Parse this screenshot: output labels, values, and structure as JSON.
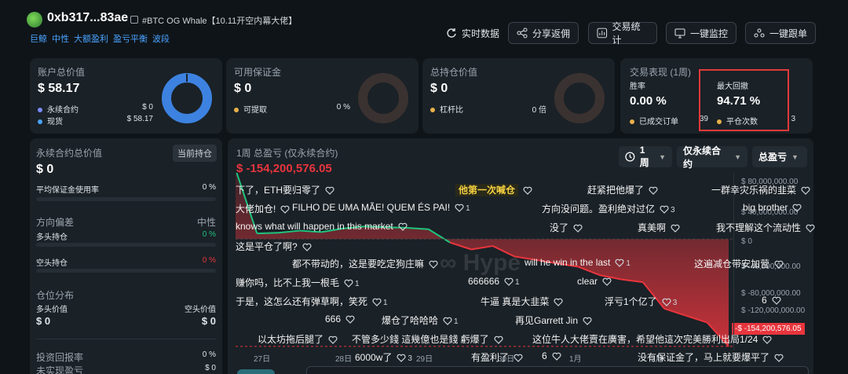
{
  "header": {
    "address": "0xb317...83ae",
    "title_tag": "#BTC OG Whale【10.11开空内幕大佬】",
    "tags": [
      "巨鲸",
      "中性",
      "大额盈利",
      "盈亏平衡",
      "波段"
    ],
    "buttons": [
      "实时数据",
      "分享返佣",
      "交易统计",
      "一键监控",
      "一键跟单"
    ]
  },
  "account": {
    "label": "账户总价值",
    "value": "$ 58.17",
    "rows": [
      {
        "label": "永续合约",
        "value": "$ 0"
      },
      {
        "label": "现货",
        "value": "$ 58.17"
      }
    ]
  },
  "margin": {
    "label": "可用保证金",
    "value": "$ 0",
    "rows": [
      {
        "label": "可提取",
        "value": "0 %"
      }
    ]
  },
  "position": {
    "label": "总持仓价值",
    "value": "$ 0",
    "rows": [
      {
        "label": "杠杆比",
        "value": "0 倍"
      }
    ]
  },
  "performance": {
    "label": "交易表现 (1周)",
    "win_label": "胜率",
    "win": "0.00 %",
    "trades_label": "已成交订单",
    "trades": "39",
    "dd_label": "最大回撤",
    "dd": "94.71 %",
    "count_label": "平仓次数",
    "count": "3"
  },
  "left": {
    "perp_label": "永续合约总价值",
    "current_btn": "当前持仓",
    "perp_value": "$ 0",
    "avg_margin_label": "平均保证金使用率",
    "avg_margin": "0 %",
    "bias_label": "方向偏差",
    "bias_value": "中性",
    "long_label": "多头持仓",
    "long": "0 %",
    "short_label": "空头持仓",
    "short": "0 %",
    "dist_label": "仓位分布",
    "long_val_label": "多头价值",
    "short_val_label": "空头价值",
    "long_val": "$ 0",
    "short_val": "$ 0",
    "roi_label": "投资回报率",
    "roi": "0 %",
    "unreal_label": "未实现盈亏",
    "unreal": "$ 0"
  },
  "chart_panel": {
    "title": "1周 总盈亏 (仅永续合约)",
    "pnl": "$ -154,200,576.05",
    "dd_period": "1周",
    "dd_scope": "仅永续合约",
    "dd_metric": "总盈亏",
    "badge": "-$ -154,200,576.05",
    "danmaku": [
      {
        "t": "下了，ETH要归零了",
        "h": ""
      },
      {
        "t": "他第一次喊仓",
        "h": ""
      },
      {
        "t": "赶紧把他爆了",
        "h": ""
      },
      {
        "t": "一群幸灾乐祸的韭菜",
        "h": ""
      },
      {
        "t": "大佬加仓!",
        "h": ""
      },
      {
        "t": "FILHO DE UMA MÃE! QUEM ÉS PAI!",
        "h": "1"
      },
      {
        "t": "方向没问题。盈利绝对过亿",
        "h": "3"
      },
      {
        "t": "big brother",
        "h": ""
      },
      {
        "t": "knows what will happen in this market",
        "h": ""
      },
      {
        "t": "没了",
        "h": ""
      },
      {
        "t": "真美啊",
        "h": ""
      },
      {
        "t": "我不理解这个流动性",
        "h": ""
      },
      {
        "t": "这是平仓了啊?",
        "h": ""
      },
      {
        "t": "都不带动的，这是要吃定狗庄嘛",
        "h": ""
      },
      {
        "t": "will he win in the last",
        "h": "1"
      },
      {
        "t": "这遍减仓带安加营",
        "h": ""
      },
      {
        "t": "赚你吗，比不上我一根毛",
        "h": "1"
      },
      {
        "t": "666666",
        "h": "1"
      },
      {
        "t": "clear",
        "h": ""
      },
      {
        "t": "于是，这怎么还有弹草啊，笑死",
        "h": "1"
      },
      {
        "t": "牛逼 真是大韭菜",
        "h": ""
      },
      {
        "t": "浮亏1个亿了",
        "h": "3"
      },
      {
        "t": "6",
        "h": ""
      },
      {
        "t": "666",
        "h": ""
      },
      {
        "t": "爆仓了哈哈哈",
        "h": "1"
      },
      {
        "t": "再见Garrett Jin",
        "h": ""
      },
      {
        "t": "以太坊拖后腿了",
        "h": ""
      },
      {
        "t": "不管多少錢 這幾億也是錢 虧爆了",
        "h": ""
      },
      {
        "t": "这位牛人大佬賣在廣害，希望他這次完美勝利出局1/24",
        "h": ""
      },
      {
        "t": "6000w了",
        "h": "3"
      },
      {
        "t": "有盈利了",
        "h": ""
      },
      {
        "t": "6",
        "h": ""
      },
      {
        "t": "没有保证金了，马上就要爆平了",
        "h": ""
      }
    ]
  },
  "chart_data": {
    "type": "area",
    "x": [
      "27日",
      "28日",
      "29日",
      "30日",
      "1月",
      "2月"
    ],
    "y_ticks": [
      "$ 80,000,000.00",
      "$ 40,000,000.00",
      "$ 0",
      "$ -40,000,000.00",
      "$ -80,000,000.00",
      "$ -120,000,000.00"
    ],
    "ylim": [
      -160000000,
      95000000
    ],
    "values": [
      100000000,
      8000000,
      9000000,
      12000000,
      10000000,
      15000000,
      18000000,
      17000000,
      16000000,
      14000000,
      -5000000,
      -15000000,
      -10000000,
      -25000000,
      -30000000,
      -35000000,
      -40000000,
      -52000000,
      -58000000,
      -62000000,
      -100000000,
      -110000000,
      -120000000,
      -154200576
    ],
    "positive_color": "#1ec47c",
    "negative_color": "#e8353d",
    "last_label": "-$ -154,200,576.05"
  },
  "colors": {
    "accent_blue": "#4aa3ff",
    "donut": "#3d82e0",
    "red": "#e8353d",
    "green": "#1ec47c",
    "highlight": "#e03a3a"
  }
}
